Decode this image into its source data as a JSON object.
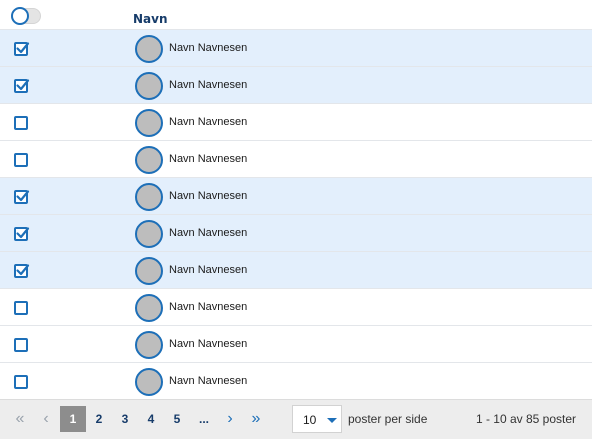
{
  "header": {
    "column_name": "Navn"
  },
  "rows": [
    {
      "name": "Navn Navnesen",
      "selected": true
    },
    {
      "name": "Navn Navnesen",
      "selected": true
    },
    {
      "name": "Navn Navnesen",
      "selected": false
    },
    {
      "name": "Navn Navnesen",
      "selected": false
    },
    {
      "name": "Navn Navnesen",
      "selected": true
    },
    {
      "name": "Navn Navnesen",
      "selected": true
    },
    {
      "name": "Navn Navnesen",
      "selected": true
    },
    {
      "name": "Navn Navnesen",
      "selected": false
    },
    {
      "name": "Navn Navnesen",
      "selected": false
    },
    {
      "name": "Navn Navnesen",
      "selected": false
    }
  ],
  "pagination": {
    "pages": [
      "1",
      "2",
      "3",
      "4",
      "5"
    ],
    "ellipsis": "...",
    "current": "1",
    "page_size": "10",
    "page_size_label": "poster per side",
    "summary": "1 - 10 av 85 poster"
  },
  "icons": {
    "first": "double-chevron-left-icon",
    "prev": "chevron-left-icon",
    "next": "chevron-right-icon",
    "last": "double-chevron-right-icon",
    "size_caret": "caret-down-icon"
  },
  "colors": {
    "accent": "#1d6fb8",
    "selected_row": "#e3effc",
    "avatar": "#bdbdbd",
    "footer": "#ededed"
  }
}
